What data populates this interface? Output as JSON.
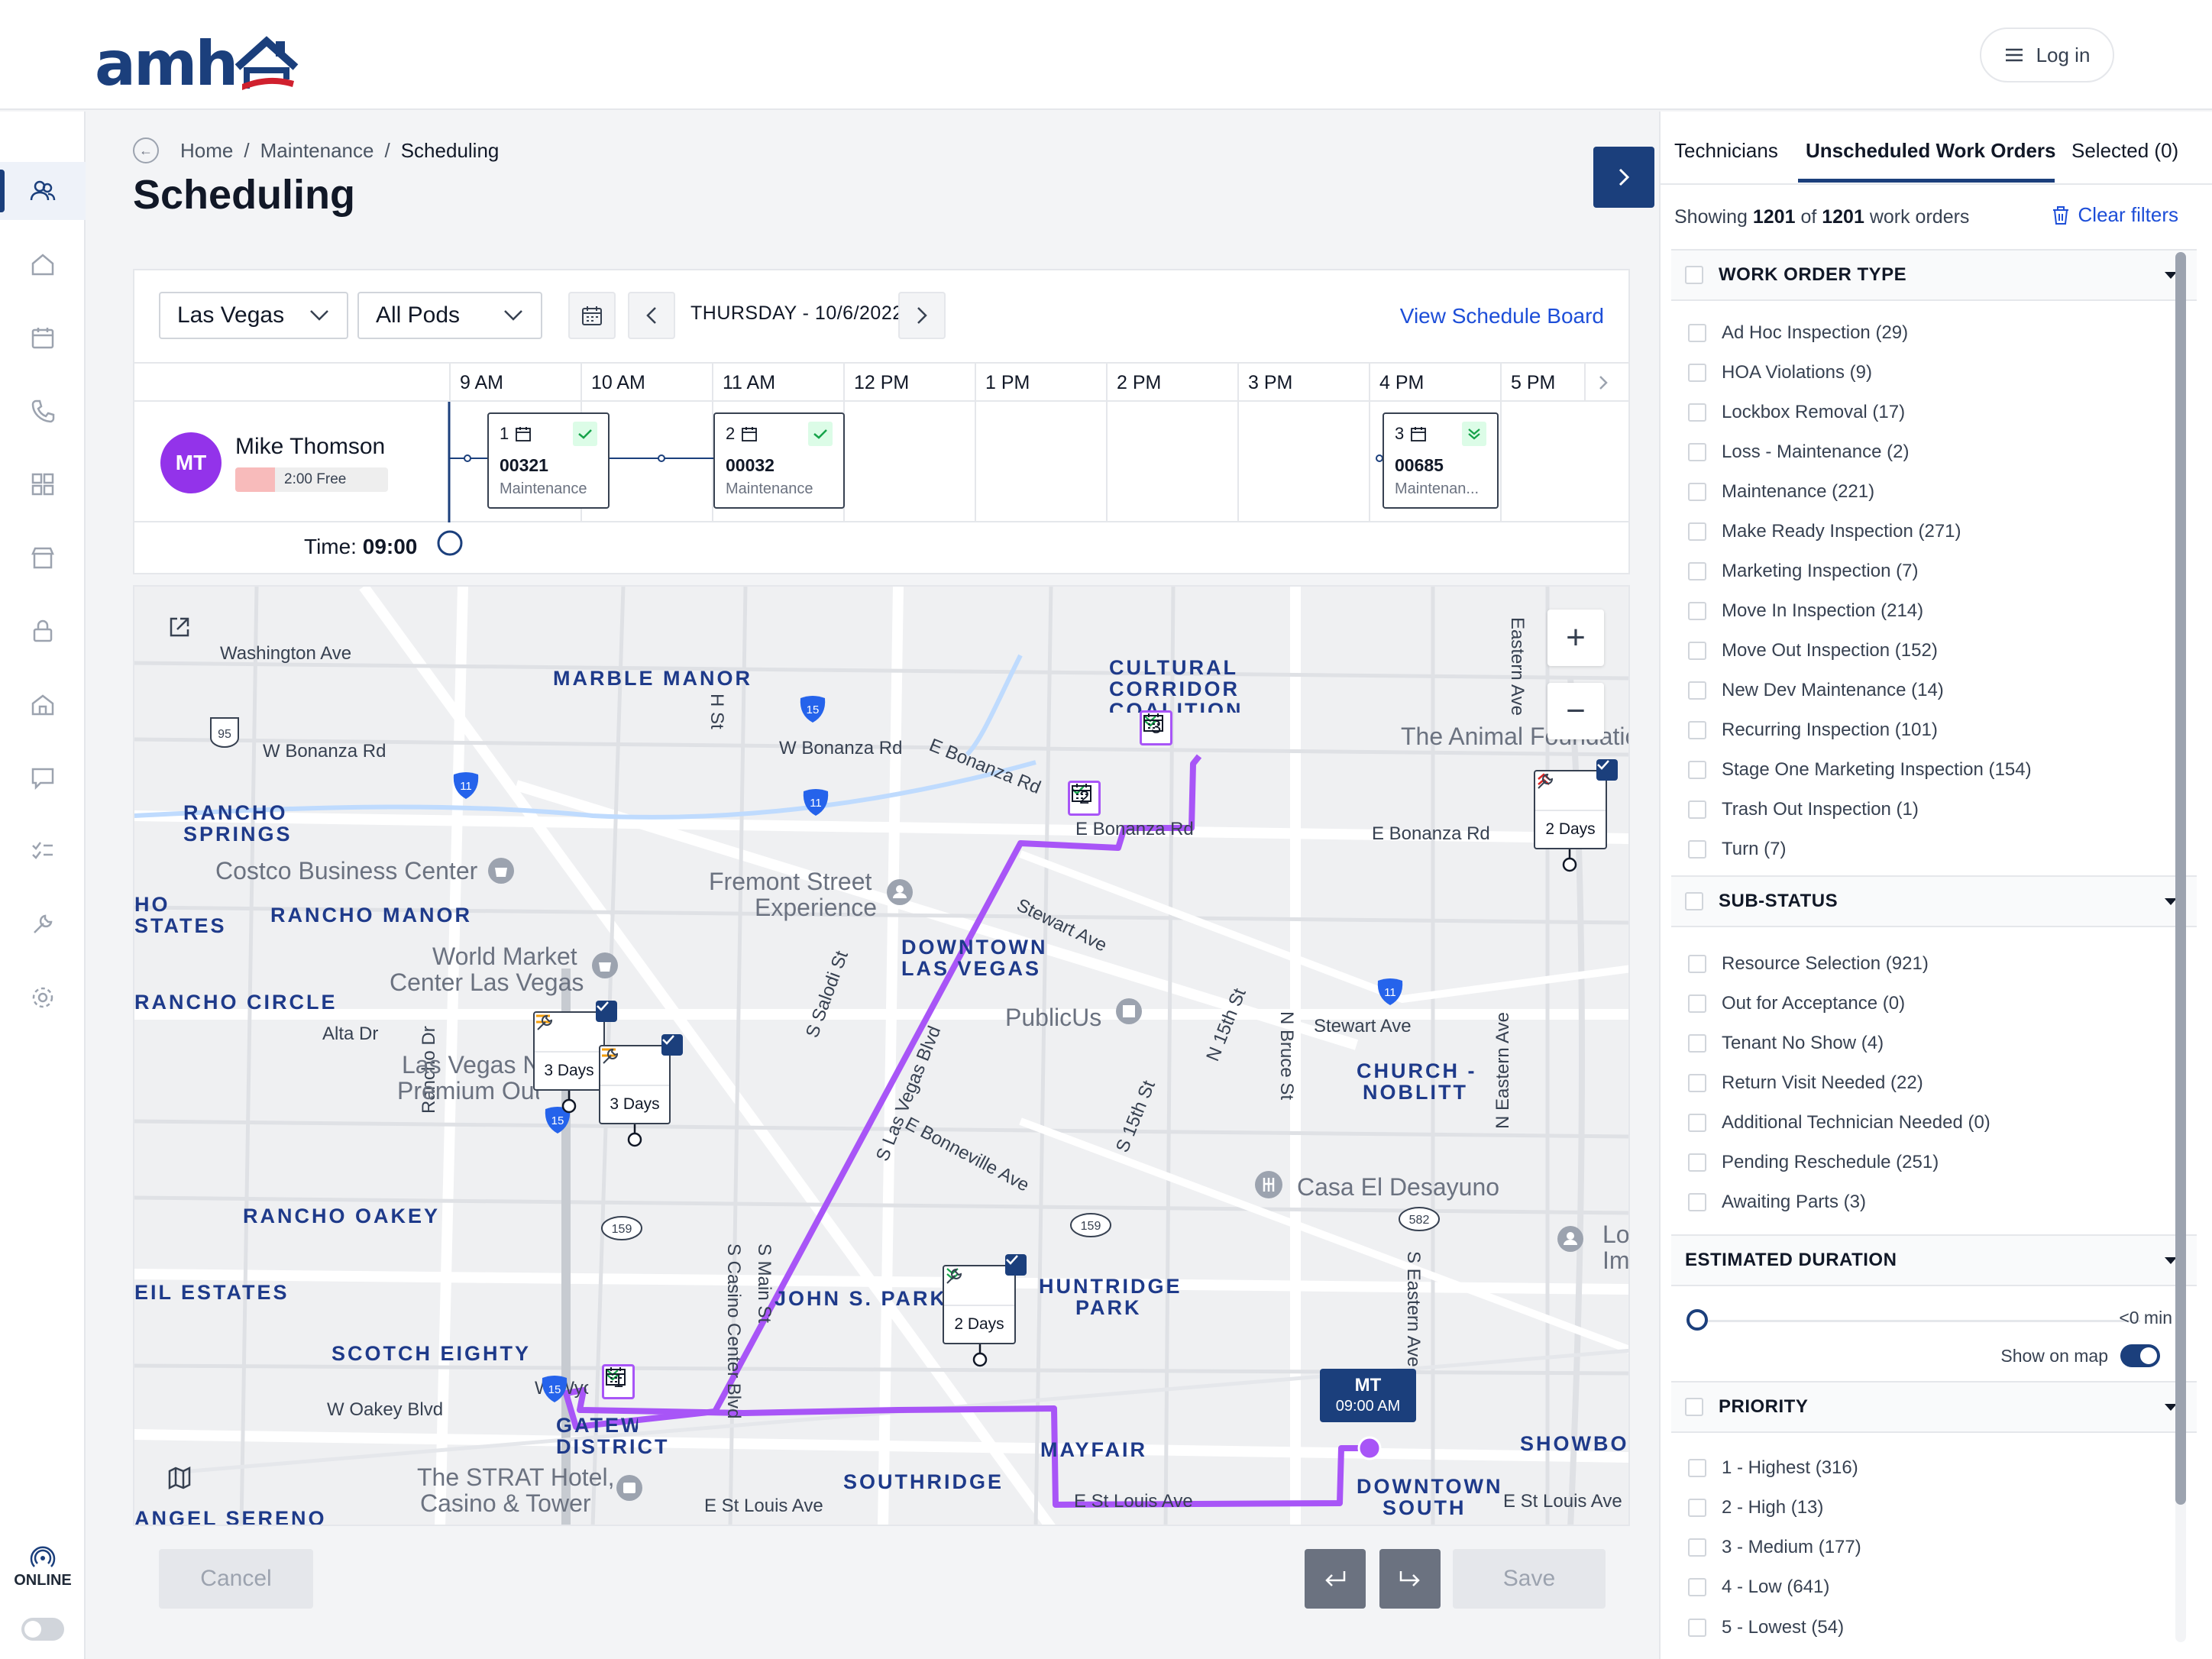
{
  "header": {
    "brand": "amh",
    "login_label": "Log in"
  },
  "status": {
    "online_label": "ONLINE"
  },
  "breadcrumb": {
    "home": "Home",
    "sep": "/",
    "maintenance": "Maintenance",
    "current": "Scheduling"
  },
  "page_title": "Scheduling",
  "filters": {
    "market": "Las Vegas",
    "pods": "All Pods",
    "date": "THURSDAY - 10/6/2022",
    "view_board": "View Schedule Board"
  },
  "timeline": {
    "hours": [
      "9 AM",
      "10 AM",
      "11 AM",
      "12 PM",
      "1 PM",
      "2 PM",
      "3 PM",
      "4 PM",
      "5 PM"
    ],
    "technician": {
      "initials": "MT",
      "name": "Mike Thomson",
      "free": "2:00 Free"
    },
    "work_orders": [
      {
        "seq": "1",
        "number": "00321",
        "type": "Maintenance"
      },
      {
        "seq": "2",
        "number": "00032",
        "type": "Maintenance"
      },
      {
        "seq": "3",
        "number": "00685",
        "type": "Maintenan..."
      }
    ],
    "time_label": "Time:",
    "time_value": "09:00"
  },
  "map": {
    "neighborhoods": [
      "MARBLE MANOR",
      "CULTURAL",
      "CORRIDOR",
      "COALITION",
      "RANCHO",
      "SPRINGS",
      "HO",
      "STATES",
      "RANCHO MANOR",
      "DOWNTOWN",
      "LAS VEGAS",
      "RANCHO CIRCLE",
      "CHURCH -",
      "NOBLITT",
      "RANCHO OAKEY",
      "EIL ESTATES",
      "JOHN S. PARK",
      "HUNTRIDGE",
      "PARK",
      "SCOTCH EIGHTY",
      "GATEWAY",
      "DISTRICT",
      "MAYFAIR",
      "SOUTHRIDGE",
      "DOWNTOWN",
      "SOUTH",
      "SHOWBOAT",
      "ANGEL SERENO"
    ],
    "streets": [
      "Washington Ave",
      "W Bonanza Rd",
      "W Bonanza Rd",
      "E Bonanza Rd",
      "E Bonanza Rd",
      "E Bonanza Rd",
      "Stewart Ave",
      "Stewart Ave",
      "Alta Dr",
      "S Las Vegas Blvd",
      "E Bonneville Ave",
      "W Oakey Blvd",
      "E St Louis Ave",
      "E St Louis Ave",
      "E St Louis Ave",
      "Eastern Ave",
      "S Eastern Ave",
      "N Eastern Ave",
      "N 15th St",
      "S 15th St",
      "N Bruce St",
      "S Main St",
      "S Casino Center Blvd",
      "Rancho Dr",
      "S Salodi St",
      "W Wyoming Ave",
      "H St"
    ],
    "pois": [
      "Costco Business Center",
      "Fremont Street",
      "Experience",
      "World Market",
      "Center Las Vegas",
      "Las Vegas North",
      "Premium Outlets",
      "PublicUs",
      "Casa El Desayuno",
      "The STRAT Hotel,",
      "Casino & Tower",
      "The Animal Foundation",
      "Lo",
      "Im"
    ],
    "route_stops": [
      "1",
      "2",
      "3"
    ],
    "pending_pins": [
      "3 Days",
      "3 Days",
      "2 Days",
      "2 Days"
    ],
    "current_marker": {
      "initials": "MT",
      "time": "09:00 AM"
    },
    "shields": [
      "95",
      "15",
      "15",
      "15",
      "11",
      "11",
      "11",
      "159",
      "159",
      "582"
    ],
    "zoom_in": "+",
    "zoom_out": "−"
  },
  "actions": {
    "cancel": "Cancel",
    "save": "Save"
  },
  "right_panel": {
    "tabs": [
      "Technicians",
      "Unscheduled Work Orders",
      "Selected (0)"
    ],
    "showing_prefix": "Showing",
    "showing_count": "1201",
    "showing_mid": "of",
    "showing_total": "1201",
    "showing_suffix": "work orders",
    "clear_filters": "Clear filters",
    "work_order_type": {
      "title": "WORK ORDER TYPE",
      "items": [
        "Ad Hoc Inspection (29)",
        "HOA Violations (9)",
        "Lockbox Removal (17)",
        "Loss - Maintenance (2)",
        "Maintenance (221)",
        "Make Ready Inspection (271)",
        "Marketing Inspection (7)",
        "Move In Inspection (214)",
        "Move Out Inspection (152)",
        "New Dev Maintenance (14)",
        "Recurring Inspection (101)",
        "Stage One Marketing Inspection (154)",
        "Trash Out Inspection (1)",
        "Turn (7)"
      ]
    },
    "sub_status": {
      "title": "SUB-STATUS",
      "items": [
        "Resource Selection (921)",
        "Out for Acceptance (0)",
        "Tenant No Show (4)",
        "Return Visit Needed (22)",
        "Additional Technician Needed (0)",
        "Pending Reschedule (251)",
        "Awaiting Parts (3)"
      ]
    },
    "estimated_duration": {
      "title": "ESTIMATED DURATION",
      "value": "<0 min",
      "show_on_map": "Show on map",
      "slider_fraction": 0.0
    },
    "priority": {
      "title": "PRIORITY",
      "items": [
        "1 - Highest (316)",
        "2 - High (13)",
        "3 - Medium (177)",
        "4 - Low (641)",
        "5 - Lowest (54)"
      ]
    }
  },
  "colors": {
    "brand_navy": "#1b3f7c",
    "route_purple": "#a855f7",
    "link_blue": "#1d4ed8",
    "brand_red": "#d0202e"
  }
}
